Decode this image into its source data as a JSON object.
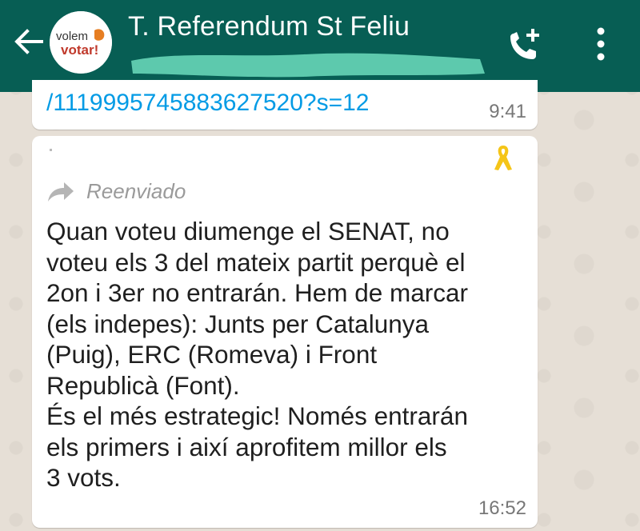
{
  "header": {
    "title": "T. Referendum St Feliu",
    "avatar_text_top": "volem",
    "avatar_text_bottom": "votar!",
    "back_icon": "arrow-left-icon",
    "call_icon": "add-call-icon",
    "menu_icon": "more-vertical-icon"
  },
  "messages": [
    {
      "link_text": "/1119995745883627520?s=12",
      "time": "9:41"
    },
    {
      "forwarded_label": "Reenviado",
      "body": "Quan voteu diumenge el SENAT, no\nvoteu els 3 del mateix partit perquè el\n2on i 3er no entrarán. Hem de marcar\n(els indepes): Junts per Catalunya\n(Puig), ERC (Romeva) i Front\nRepublicà (Font).\nÉs el més estrategic! Només entrarán\nels primers i així aprofitem millor els\n3 vots.",
      "time": "16:52",
      "ribbon_icon": "yellow-ribbon-icon"
    }
  ],
  "colors": {
    "header": "#075e54",
    "link": "#039be5",
    "redaction": "#5dc9ad",
    "ribbon": "#f5c518"
  }
}
